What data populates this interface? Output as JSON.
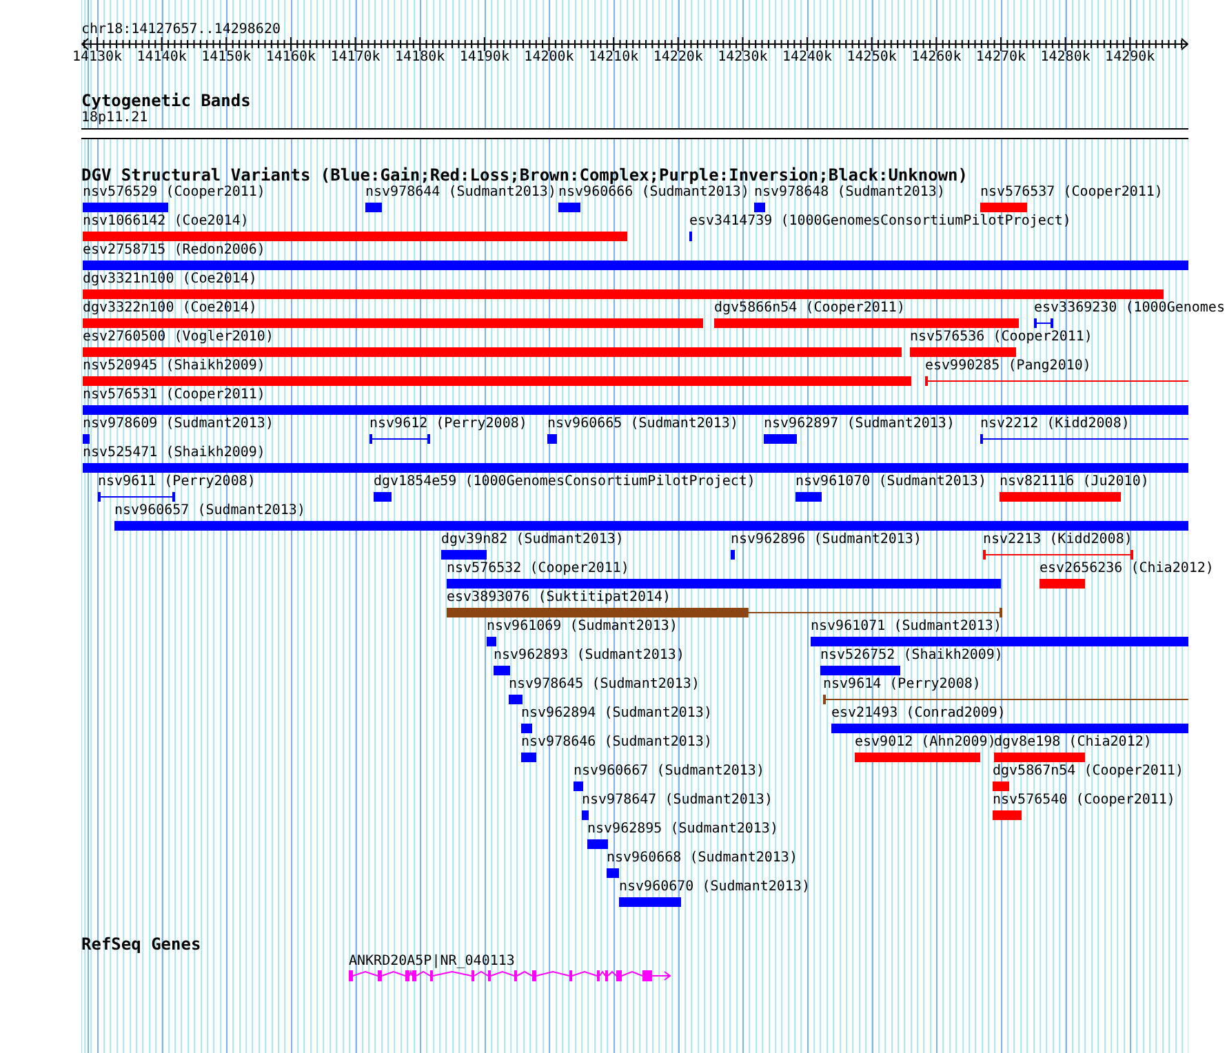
{
  "ruler": {
    "location": "chr18:14127657..14298620",
    "ticks": [
      "14130k",
      "14140k",
      "14150k",
      "14160k",
      "14170k",
      "14180k",
      "14190k",
      "14200k",
      "14210k",
      "14220k",
      "14230k",
      "14240k",
      "14250k",
      "14260k",
      "14270k",
      "14280k",
      "14290k"
    ]
  },
  "cytogenetic_bands": {
    "title": "Cytogenetic Bands",
    "band": "18p11.21"
  },
  "dgv_variants": {
    "title": "DGV Structural Variants (Blue:Gain;Red:Loss;Brown:Complex;Purple:Inversion;Black:Unknown)",
    "variants": [
      {
        "name": "nsv576529 (Cooper2011)",
        "kind": "bar",
        "color": "#0000ff"
      },
      {
        "name": "nsv978644 (Sudmant2013)",
        "kind": "bar",
        "color": "#0000ff"
      },
      {
        "name": "nsv960666 (Sudmant2013)",
        "kind": "bar",
        "color": "#0000ff"
      },
      {
        "name": "nsv978648 (Sudmant2013)",
        "kind": "bar",
        "color": "#0000ff"
      },
      {
        "name": "nsv576537 (Cooper2011)",
        "kind": "bar",
        "color": "#ff0000"
      },
      {
        "name": "nsv1066142 (Coe2014)",
        "kind": "bar",
        "color": "#ff0000"
      },
      {
        "name": "esv3414739 (1000GenomesConsortiumPilotProject)",
        "kind": "bar",
        "color": "#0000ff"
      },
      {
        "name": "esv2758715 (Redon2006)",
        "kind": "bar",
        "color": "#0000ff"
      },
      {
        "name": "dgv3321n100 (Coe2014)",
        "kind": "bar",
        "color": "#ff0000"
      },
      {
        "name": "dgv3322n100 (Coe2014)",
        "kind": "bar",
        "color": "#ff0000"
      },
      {
        "name": "dgv5866n54 (Cooper2011)",
        "kind": "bar",
        "color": "#ff0000"
      },
      {
        "name": "esv3369230 (1000Genomes",
        "kind": "line",
        "color": "#0000ff",
        "end_cap": true
      },
      {
        "name": "esv2760500 (Vogler2010)",
        "kind": "bar",
        "color": "#ff0000"
      },
      {
        "name": "nsv576536 (Cooper2011)",
        "kind": "bar",
        "color": "#ff0000"
      },
      {
        "name": "nsv520945 (Shaikh2009)",
        "kind": "bar",
        "color": "#ff0000"
      },
      {
        "name": "esv990285 (Pang2010)",
        "kind": "line",
        "color": "#ff0000",
        "end_cap": false
      },
      {
        "name": "nsv576531 (Cooper2011)",
        "kind": "bar",
        "color": "#0000ff"
      },
      {
        "name": "nsv978609 (Sudmant2013)",
        "kind": "bar",
        "color": "#0000ff"
      },
      {
        "name": "nsv9612 (Perry2008)",
        "kind": "line",
        "color": "#0000ff",
        "end_cap": true
      },
      {
        "name": "nsv960665 (Sudmant2013)",
        "kind": "bar",
        "color": "#0000ff"
      },
      {
        "name": "nsv962897 (Sudmant2013)",
        "kind": "bar",
        "color": "#0000ff"
      },
      {
        "name": "nsv2212 (Kidd2008)",
        "kind": "line",
        "color": "#0000ff",
        "end_cap": false
      },
      {
        "name": "nsv525471 (Shaikh2009)",
        "kind": "bar",
        "color": "#0000ff"
      },
      {
        "name": "nsv9611 (Perry2008)",
        "kind": "line",
        "color": "#0000ff",
        "end_cap": true
      },
      {
        "name": "dgv1854e59 (1000GenomesConsortiumPilotProject)",
        "kind": "bar",
        "color": "#0000ff"
      },
      {
        "name": "nsv961070 (Sudmant2013)",
        "kind": "bar",
        "color": "#0000ff"
      },
      {
        "name": "nsv821116 (Ju2010)",
        "kind": "bar",
        "color": "#ff0000"
      },
      {
        "name": "nsv960657 (Sudmant2013)",
        "kind": "bar",
        "color": "#0000ff"
      },
      {
        "name": "dgv39n82 (Sudmant2013)",
        "kind": "bar",
        "color": "#0000ff"
      },
      {
        "name": "nsv962896 (Sudmant2013)",
        "kind": "bar",
        "color": "#0000ff"
      },
      {
        "name": "nsv2213 (Kidd2008)",
        "kind": "line",
        "color": "#ff0000",
        "end_cap": true
      },
      {
        "name": "nsv576532 (Cooper2011)",
        "kind": "bar",
        "color": "#0000ff"
      },
      {
        "name": "esv2656236 (Chia2012)",
        "kind": "bar",
        "color": "#ff0000"
      },
      {
        "name": "esv3893076 (Suktitipat2014)",
        "kind": "bar-line",
        "color": "#8b4513"
      },
      {
        "name": "nsv961069 (Sudmant2013)",
        "kind": "bar",
        "color": "#0000ff"
      },
      {
        "name": "nsv961071 (Sudmant2013)",
        "kind": "bar",
        "color": "#0000ff"
      },
      {
        "name": "nsv962893 (Sudmant2013)",
        "kind": "bar",
        "color": "#0000ff"
      },
      {
        "name": "nsv526752 (Shaikh2009)",
        "kind": "bar",
        "color": "#0000ff"
      },
      {
        "name": "nsv978645 (Sudmant2013)",
        "kind": "bar",
        "color": "#0000ff"
      },
      {
        "name": "nsv9614 (Perry2008)",
        "kind": "line",
        "color": "#8b4513",
        "end_cap": false
      },
      {
        "name": "nsv962894 (Sudmant2013)",
        "kind": "bar",
        "color": "#0000ff"
      },
      {
        "name": "esv21493 (Conrad2009)",
        "kind": "bar",
        "color": "#0000ff"
      },
      {
        "name": "nsv978646 (Sudmant2013)",
        "kind": "bar",
        "color": "#0000ff"
      },
      {
        "name": "esv9012 (Ahn2009)",
        "kind": "bar",
        "color": "#ff0000"
      },
      {
        "name": "dgv8e198 (Chia2012)",
        "kind": "bar",
        "color": "#ff0000"
      },
      {
        "name": "nsv960667 (Sudmant2013)",
        "kind": "bar",
        "color": "#0000ff"
      },
      {
        "name": "dgv5867n54 (Cooper2011)",
        "kind": "bar",
        "color": "#ff0000"
      },
      {
        "name": "nsv978647 (Sudmant2013)",
        "kind": "bar",
        "color": "#0000ff"
      },
      {
        "name": "nsv576540 (Cooper2011)",
        "kind": "bar",
        "color": "#ff0000"
      },
      {
        "name": "nsv962895 (Sudmant2013)",
        "kind": "bar",
        "color": "#0000ff"
      },
      {
        "name": "nsv960668 (Sudmant2013)",
        "kind": "bar",
        "color": "#0000ff"
      },
      {
        "name": "nsv960670 (Sudmant2013)",
        "kind": "bar",
        "color": "#0000ff"
      }
    ]
  },
  "refseq_genes": {
    "title": "RefSeq Genes",
    "genes": [
      {
        "label": "ANKRD20A5P|NR_040113",
        "forward": true
      }
    ]
  }
}
